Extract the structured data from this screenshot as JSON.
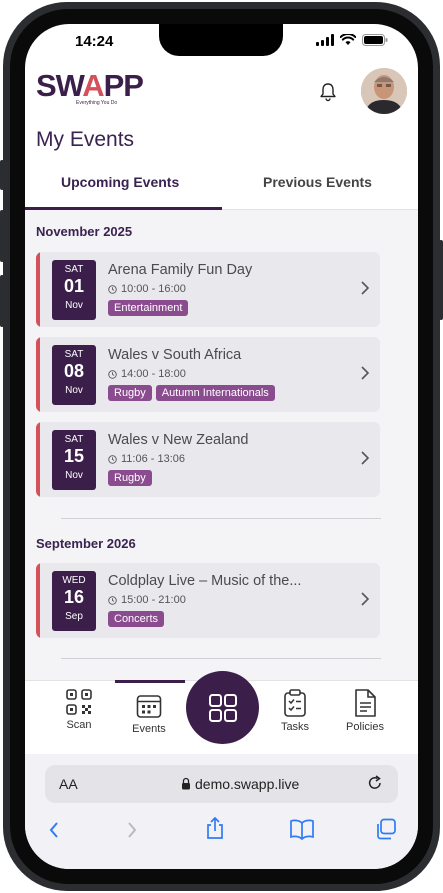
{
  "status": {
    "time": "14:24"
  },
  "header": {
    "logo_main": "SW",
    "logo_accent": "A",
    "logo_end": "PP",
    "logo_tagline": "Everything You Do"
  },
  "page": {
    "title": "My Events"
  },
  "tabs": [
    {
      "label": "Upcoming Events",
      "active": true
    },
    {
      "label": "Previous Events",
      "active": false
    }
  ],
  "sections": [
    {
      "month": "November 2025",
      "events": [
        {
          "dow": "SAT",
          "day": "01",
          "mon": "Nov",
          "title": "Arena Family Fun Day",
          "time": "10:00 - 16:00",
          "tags": [
            "Entertainment"
          ]
        },
        {
          "dow": "SAT",
          "day": "08",
          "mon": "Nov",
          "title": "Wales v South Africa",
          "time": "14:00 - 18:00",
          "tags": [
            "Rugby",
            "Autumn Internationals"
          ]
        },
        {
          "dow": "SAT",
          "day": "15",
          "mon": "Nov",
          "title": "Wales v New Zealand",
          "time": "11:06 - 13:06",
          "tags": [
            "Rugby"
          ]
        }
      ]
    },
    {
      "month": "September 2026",
      "events": [
        {
          "dow": "WED",
          "day": "16",
          "mon": "Sep",
          "title": "Coldplay Live – Music of the...",
          "time": "15:00 - 21:00",
          "tags": [
            "Concerts"
          ]
        }
      ]
    }
  ],
  "nav": {
    "items": [
      {
        "label": "Scan",
        "icon": "qr-code-icon"
      },
      {
        "label": "Events",
        "icon": "calendar-icon",
        "active": true
      },
      {
        "label": "",
        "icon": "grid-icon"
      },
      {
        "label": "Tasks",
        "icon": "clipboard-icon"
      },
      {
        "label": "Policies",
        "icon": "document-icon"
      }
    ]
  },
  "browser": {
    "aa": "AA",
    "url": "demo.swapp.live"
  },
  "colors": {
    "brand": "#3b1f4a",
    "accent": "#d4505b",
    "tag": "#8a4b8f"
  }
}
